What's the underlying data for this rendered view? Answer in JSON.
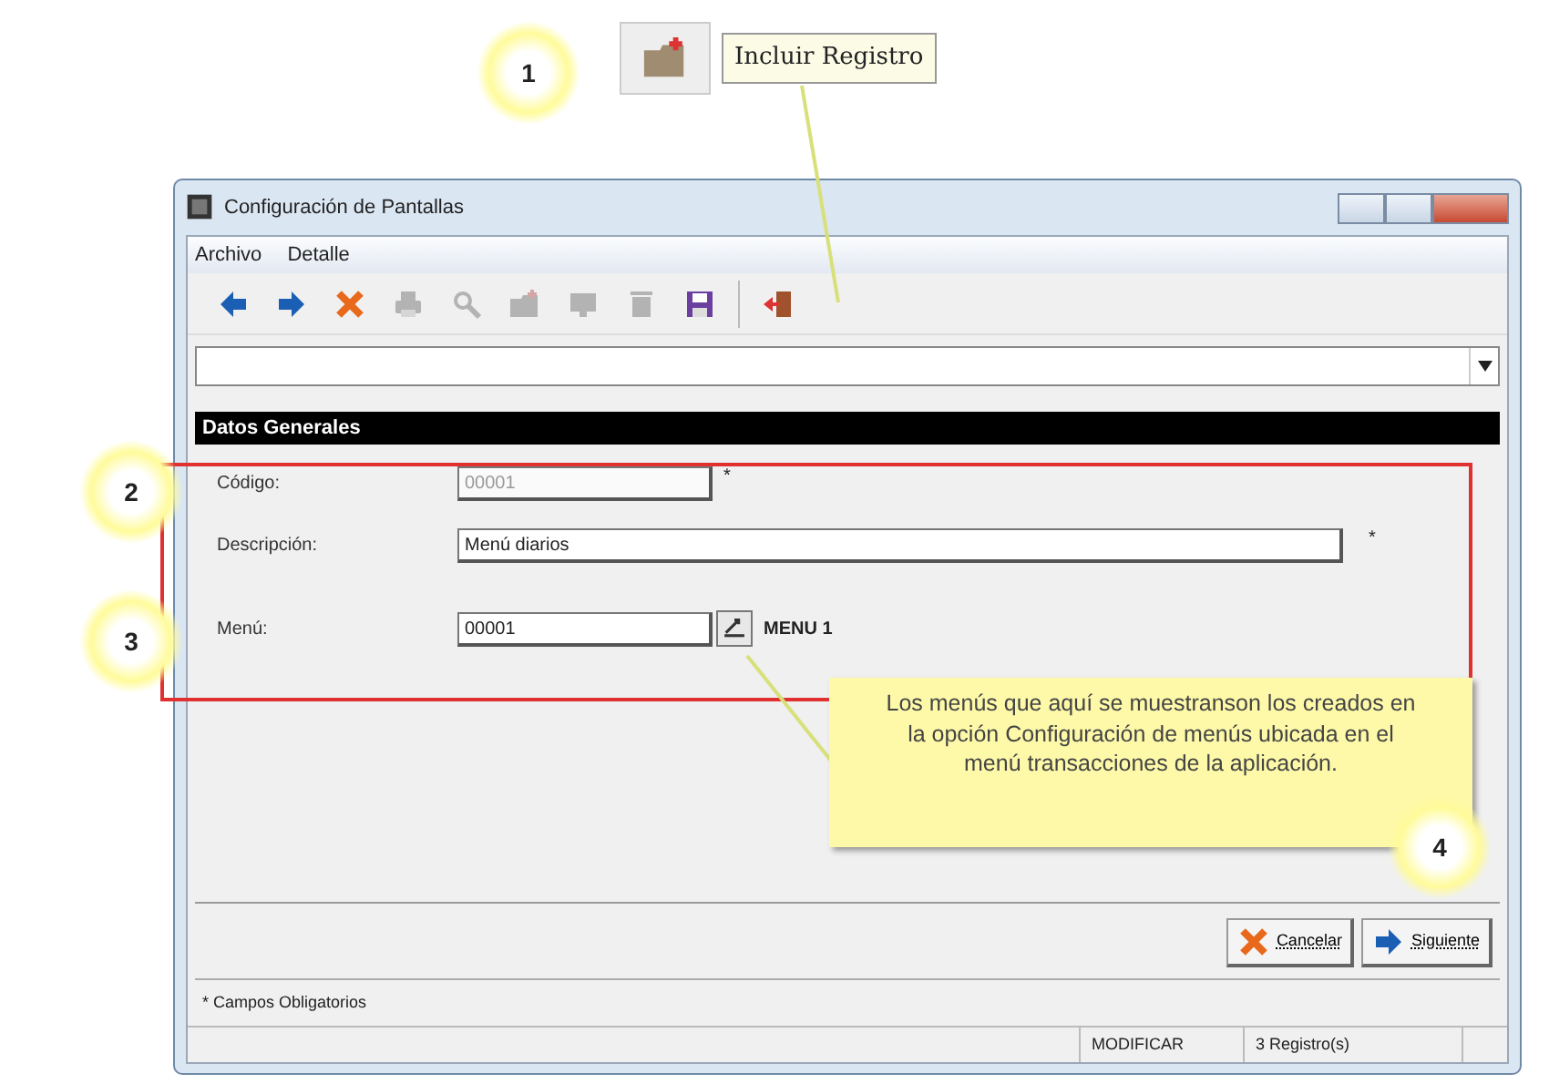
{
  "callouts": [
    {
      "number": "1"
    },
    {
      "number": "2"
    },
    {
      "number": "3"
    },
    {
      "number": "4"
    }
  ],
  "tooltip": {
    "label": "Incluir Registro"
  },
  "note": "Los menús que aquí se muestranson los creados en la opción Configuración de menús ubicada en el menú transacciones de la aplicación.",
  "window": {
    "title": "Configuración de Pantallas"
  },
  "menu": [
    "Archivo",
    "Detalle"
  ],
  "toolbar": [
    {
      "kind": "back",
      "disabled": false
    },
    {
      "kind": "forward",
      "disabled": false
    },
    {
      "kind": "delete",
      "disabled": false
    },
    {
      "kind": "print",
      "disabled": true
    },
    {
      "kind": "search",
      "disabled": true
    },
    {
      "kind": "new",
      "disabled": true
    },
    {
      "kind": "view",
      "disabled": true
    },
    {
      "kind": "trash",
      "disabled": true
    },
    {
      "kind": "save",
      "disabled": false
    },
    {
      "kind": "exit",
      "disabled": false
    }
  ],
  "section": {
    "title": "Datos Generales"
  },
  "fields": [
    {
      "kind": "short",
      "label": "Código:",
      "value": "00001",
      "disabled": true,
      "mark": "*"
    },
    {
      "kind": "wide",
      "label": "Descripción:",
      "value": "Menú diarios",
      "disabled": false,
      "mark": "*"
    },
    {
      "kind": "lookup",
      "label": "Menú:",
      "value": "00001",
      "disabled": false,
      "lookup_text": "MENU 1"
    }
  ],
  "buttons": [
    {
      "kind": "cancel",
      "label": "Cancelar"
    },
    {
      "kind": "next",
      "label": "Siguiente"
    }
  ],
  "footer_note": "* Campos Obligatorios",
  "status_bar": [
    "MODIFICAR",
    "3 Registro(s)"
  ]
}
